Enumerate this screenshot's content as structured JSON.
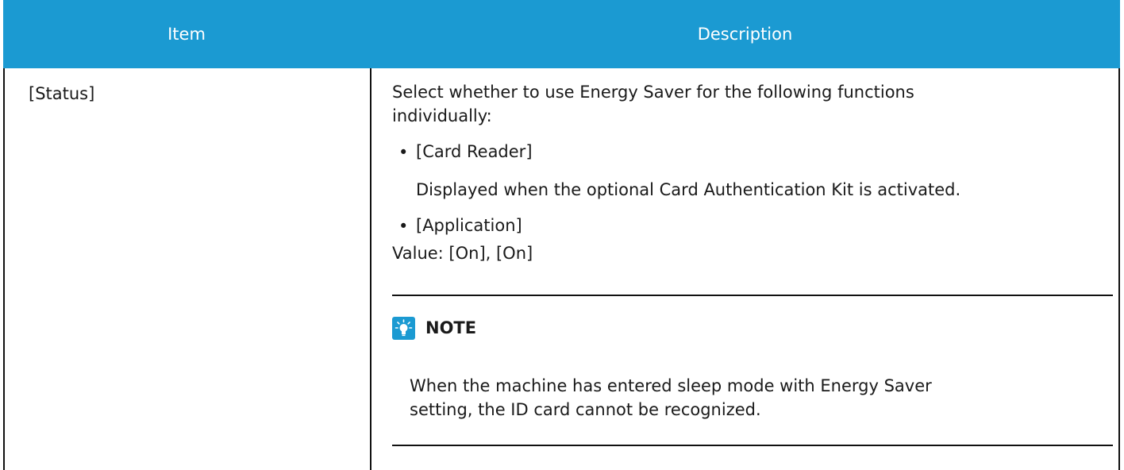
{
  "table": {
    "headers": {
      "item": "Item",
      "description": "Description"
    },
    "row": {
      "item": "[Status]",
      "description": {
        "intro_line1": "Select whether to use Energy Saver for the following functions",
        "intro_line2": "individually:",
        "bullets": [
          {
            "label": "[Card Reader]",
            "detail": "Displayed when the optional Card Authentication Kit is activated."
          },
          {
            "label": "[Application]"
          }
        ],
        "value": "Value: [On], [On]",
        "note": {
          "icon": "note-lightbulb-icon",
          "title": "NOTE",
          "line1": "When the machine has entered sleep mode with Energy Saver",
          "line2": "setting, the ID card cannot be recognized."
        }
      }
    }
  },
  "colors": {
    "header_bg": "#1b9ad2",
    "header_text": "#ffffff",
    "rule": "#111111"
  }
}
